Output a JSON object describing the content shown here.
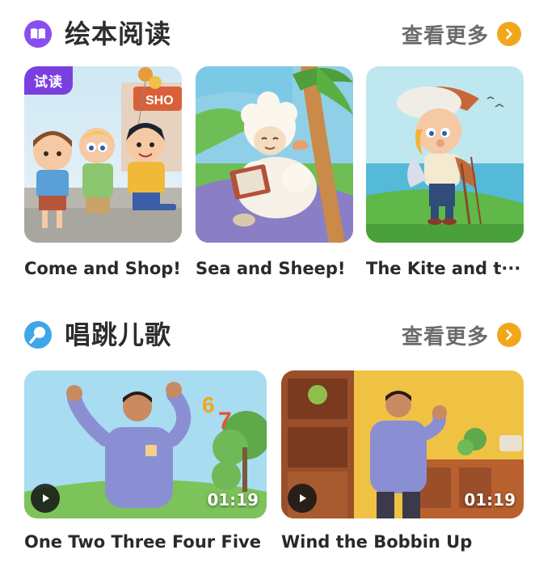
{
  "picture_books": {
    "title": "绘本阅读",
    "more": "查看更多",
    "items": [
      {
        "label": "Come and Shop!",
        "badge": "试读"
      },
      {
        "label": "Sea and Sheep!"
      },
      {
        "label": "The Kite and t···"
      }
    ]
  },
  "songs": {
    "title": "唱跳儿歌",
    "more": "查看更多",
    "items": [
      {
        "label": "One Two Three Four Five",
        "duration": "01:19"
      },
      {
        "label": "Wind the Bobbin Up",
        "duration": "01:19"
      }
    ]
  },
  "colors": {
    "book_icon": "#8a4df0",
    "song_icon": "#3fa6e8",
    "more_arrow": "#f2a71b",
    "trial_badge": "#7b3fe0"
  },
  "icons": {
    "book_section": "open-book-icon",
    "song_section": "microphone-icon",
    "more": "chevron-right-icon",
    "play": "play-icon"
  }
}
